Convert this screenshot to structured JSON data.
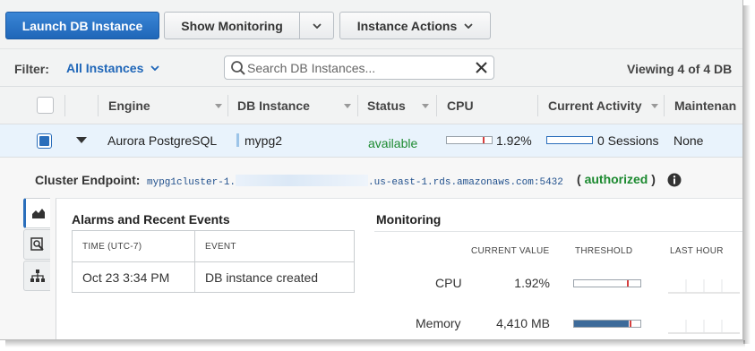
{
  "toolbar": {
    "launch_label": "Launch DB Instance",
    "monitoring_label": "Show Monitoring",
    "actions_label": "Instance Actions"
  },
  "filter": {
    "label": "Filter:",
    "selected": "All Instances",
    "search_placeholder": "Search DB Instances...",
    "viewing": "Viewing 4 of 4 DB"
  },
  "table": {
    "columns": [
      "Engine",
      "DB Instance",
      "Status",
      "CPU",
      "Current Activity",
      "Maintenan"
    ],
    "row": {
      "engine": "Aurora PostgreSQL",
      "db_instance": "mypg2",
      "status": "available",
      "cpu": "1.92%",
      "cpu_level": 0.8,
      "activity": "0 Sessions",
      "maintenance": "None"
    }
  },
  "details": {
    "endpoint_label": "Cluster Endpoint:",
    "endpoint_prefix": "mypg1cluster-1.",
    "endpoint_suffix": ".us-east-1.rds.amazonaws.com:5432",
    "auth_open": "(",
    "auth_status": "authorized",
    "auth_close": ")",
    "alarms_title": "Alarms and Recent Events",
    "events_headers": [
      "TIME (UTC-7)",
      "EVENT"
    ],
    "events": [
      {
        "time": "Oct 23 3:34 PM",
        "event": "DB instance created"
      }
    ],
    "monitoring_title": "Monitoring",
    "monitoring_headers": [
      "CURRENT VALUE",
      "THRESHOLD",
      "LAST HOUR"
    ],
    "metrics": [
      {
        "name": "CPU",
        "value": "1.92%",
        "threshold_fill": 0.0,
        "threshold_mark": 0.8
      },
      {
        "name": "Memory",
        "value": "4,410 MB",
        "threshold_fill": 0.82,
        "threshold_mark": 0.84
      }
    ]
  },
  "colors": {
    "primary": "#1f66b8",
    "status_ok": "#1c8a30",
    "alert": "#d63f3f"
  }
}
